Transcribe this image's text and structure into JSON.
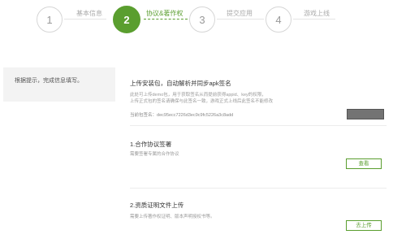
{
  "stepper": {
    "steps": [
      {
        "number": "1",
        "label": "基本信息"
      },
      {
        "number": "2",
        "label": "协议&著作权"
      },
      {
        "number": "3",
        "label": "提交应用"
      },
      {
        "number": "4",
        "label": "游戏上线"
      }
    ]
  },
  "sidebar": {
    "hint": "根据提示，完成信息填写。"
  },
  "upload_apk": {
    "title": "上传安装包，自动解析并同步apk签名",
    "desc_line1": "此处可上传demo包，用于获取签名从而提前获得appid、key的权限，",
    "desc_line2": "上传正式包的签名请确保与此签名一致，游戏正式上线后此签名不能修改",
    "signature_label": "当前包签名：",
    "signature_value": "dec95ecc7226d3ec9c9fc5226a3c8add"
  },
  "agreement": {
    "title": "1.合作协议签署",
    "desc": "需要签署专属的合作协议",
    "button_label": "查看"
  },
  "certificate": {
    "title": "2.资质证明文件上传",
    "desc": "需要上传著作权证明、版本声明授权书等。",
    "button_label": "去上传"
  }
}
